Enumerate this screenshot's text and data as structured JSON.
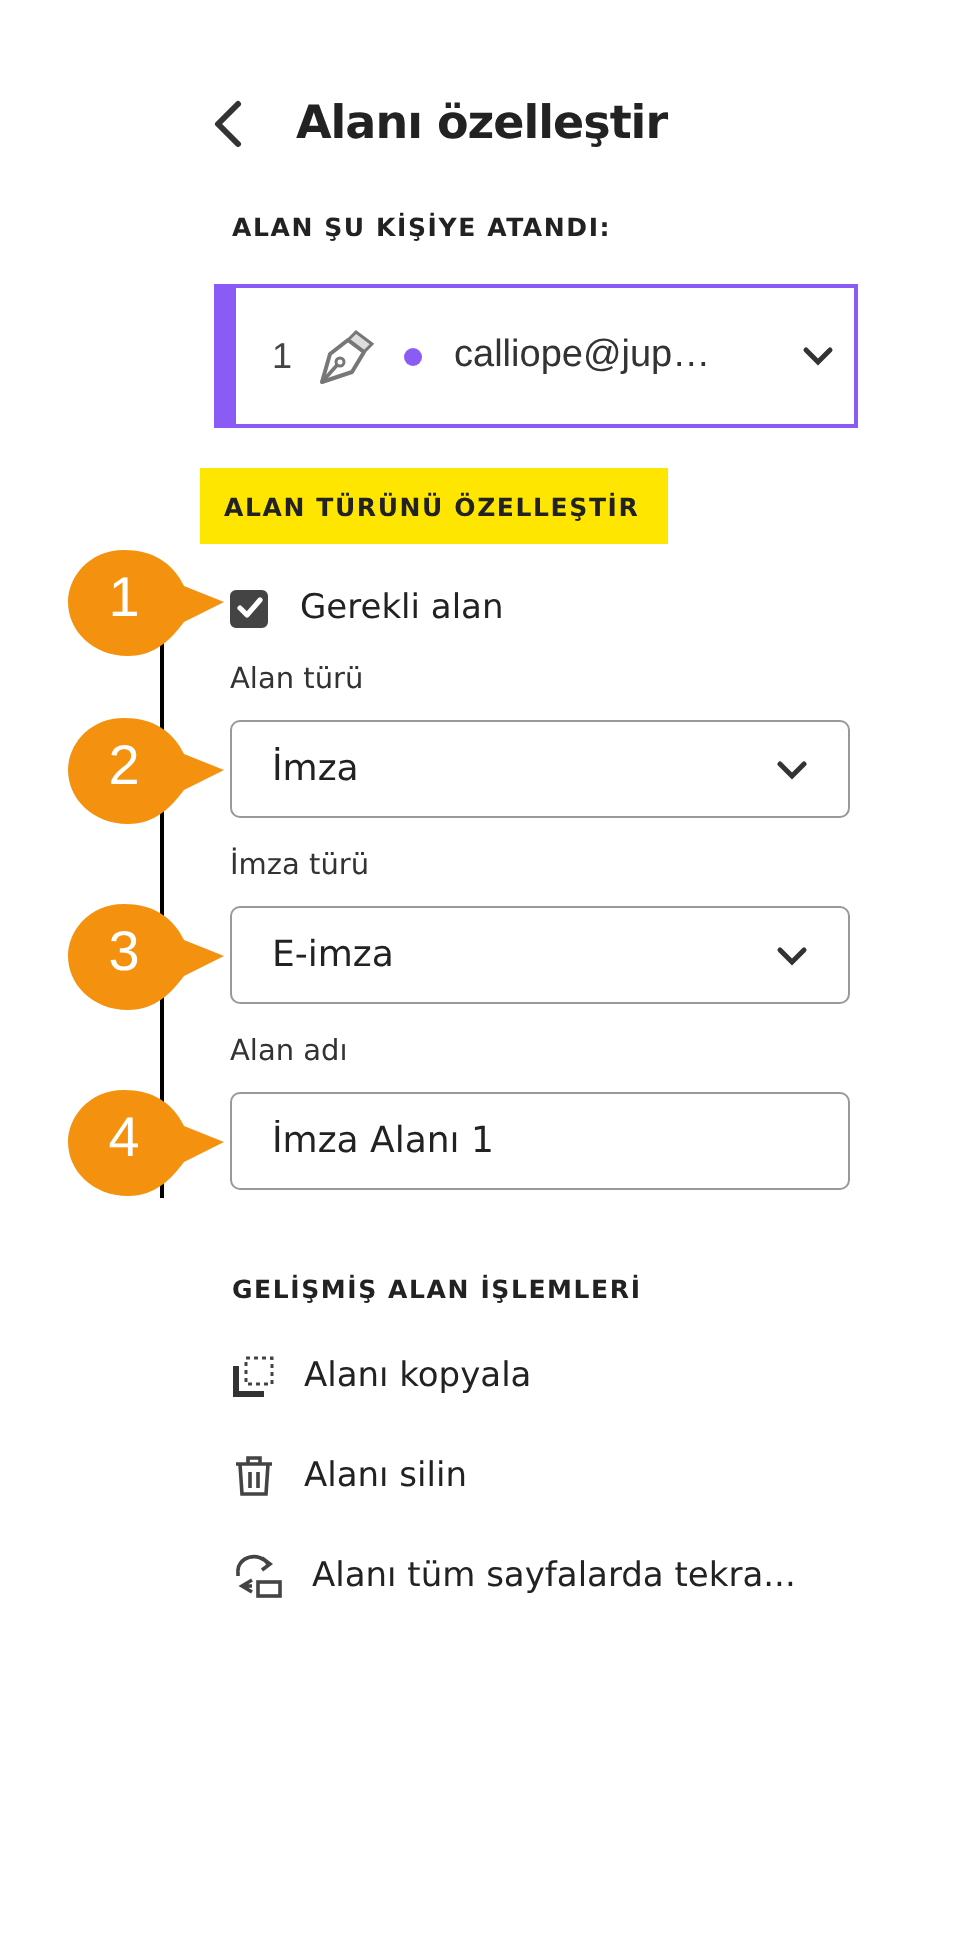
{
  "header": {
    "title": "Alanı özelleştir"
  },
  "assignment": {
    "label": "ALAN ŞU KİŞİYE ATANDI:",
    "number": "1",
    "color": "#8a5cf5",
    "email": "calliope@jup…"
  },
  "customize": {
    "label": "ALAN TÜRÜNÜ ÖZELLEŞTİR",
    "highlighted": true
  },
  "fields": [
    {
      "kind": "checkbox",
      "label": "Gerekli alan",
      "checked": true,
      "callout": "1"
    },
    {
      "kind": "select",
      "label": "Alan türü",
      "value": "İmza",
      "callout": "2"
    },
    {
      "kind": "select",
      "label": "İmza türü",
      "value": "E-imza",
      "callout": "3"
    },
    {
      "kind": "text",
      "label": "Alan adı",
      "value": "İmza Alanı 1",
      "callout": "4"
    }
  ],
  "advanced": {
    "label": "GELİŞMİŞ ALAN İŞLEMLERİ",
    "actions": [
      {
        "kind": "copy",
        "label": "Alanı kopyala"
      },
      {
        "kind": "delete",
        "label": "Alanı silin"
      },
      {
        "kind": "repeat",
        "label": "Alanı tüm sayfalarda tekra..."
      }
    ]
  }
}
